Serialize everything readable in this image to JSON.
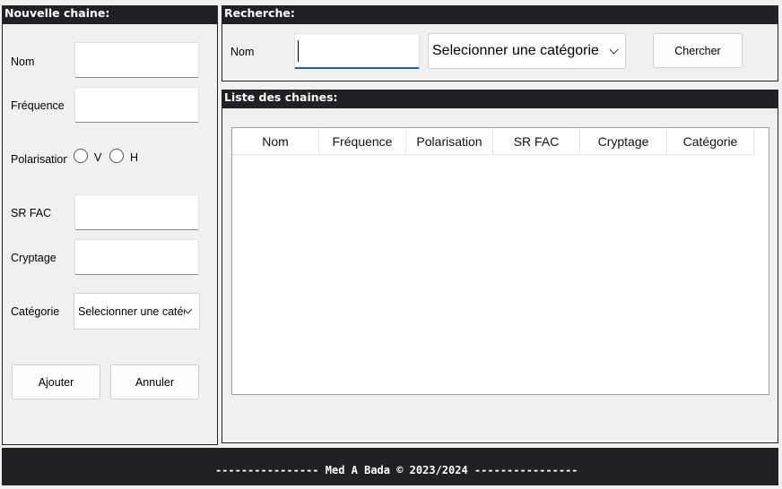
{
  "new_channel": {
    "title": "Nouvelle chaine:",
    "labels": {
      "nom": "Nom",
      "frequence": "Fréquence",
      "polarisation": "Polarisation",
      "sr_fac": "SR FAC",
      "cryptage": "Cryptage",
      "categorie": "Catégorie"
    },
    "radio_v": "V",
    "radio_h": "H",
    "category_select": "Selecionner une catégorie",
    "add_button": "Ajouter",
    "cancel_button": "Annuler"
  },
  "search": {
    "title": "Recherche:",
    "nom_label": "Nom",
    "nom_value": "",
    "category_select": "Selecionner une catégorie",
    "search_button": "Chercher"
  },
  "channel_list": {
    "title": "Liste des chaines:",
    "columns": [
      "Nom",
      "Fréquence",
      "Polarisation",
      "SR FAC",
      "Cryptage",
      "Catégorie"
    ]
  },
  "footer": {
    "text": "---------------- Med A Bada © 2023/2024 ----------------"
  }
}
